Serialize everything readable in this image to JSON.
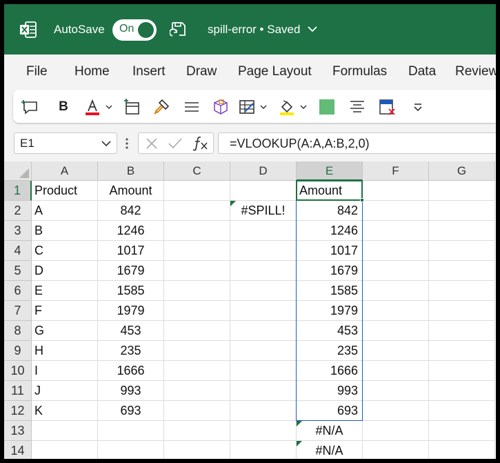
{
  "titlebar": {
    "autosave_label": "AutoSave",
    "toggle_state": "On",
    "doc_title": "spill-error • Saved",
    "brand_color": "#1e7145"
  },
  "menu": [
    "File",
    "Home",
    "Insert",
    "Draw",
    "Page Layout",
    "Formulas",
    "Data",
    "Review"
  ],
  "ribbon": {
    "icons": [
      "comment-icon",
      "bold-icon",
      "font-color-icon",
      "add-table-icon",
      "format-painter-icon",
      "align-icon",
      "3d-box-icon",
      "table-format-icon",
      "fill-color-icon",
      "green-swatch-icon",
      "center-align-icon",
      "delete-sheet-icon",
      "more-icon"
    ],
    "bold_label": "B",
    "font_color": "#e81123",
    "fill_color": "#ffe600",
    "swatch_color": "#62bb76"
  },
  "formula_bar": {
    "name_box": "E1",
    "formula": "=VLOOKUP(A:A,A:B,2,0)"
  },
  "grid": {
    "columns": [
      "A",
      "B",
      "C",
      "D",
      "E",
      "F",
      "G"
    ],
    "rows": [
      "1",
      "2",
      "3",
      "4",
      "5",
      "6",
      "7",
      "8",
      "9",
      "10",
      "11",
      "12",
      "13",
      "14"
    ],
    "col_a": [
      "Product",
      "A",
      "B",
      "C",
      "D",
      "E",
      "F",
      "G",
      "H",
      "I",
      "J",
      "K",
      "",
      ""
    ],
    "col_b": [
      "Amount",
      "842",
      "1246",
      "1017",
      "1679",
      "1585",
      "1979",
      "453",
      "235",
      "1666",
      "993",
      "693",
      "",
      ""
    ],
    "d2": "#SPILL!",
    "col_e": [
      "Amount",
      "842",
      "1246",
      "1017",
      "1679",
      "1585",
      "1979",
      "453",
      "235",
      "1666",
      "993",
      "693",
      "#N/A",
      "#N/A"
    ],
    "selected_cell": "E1"
  }
}
